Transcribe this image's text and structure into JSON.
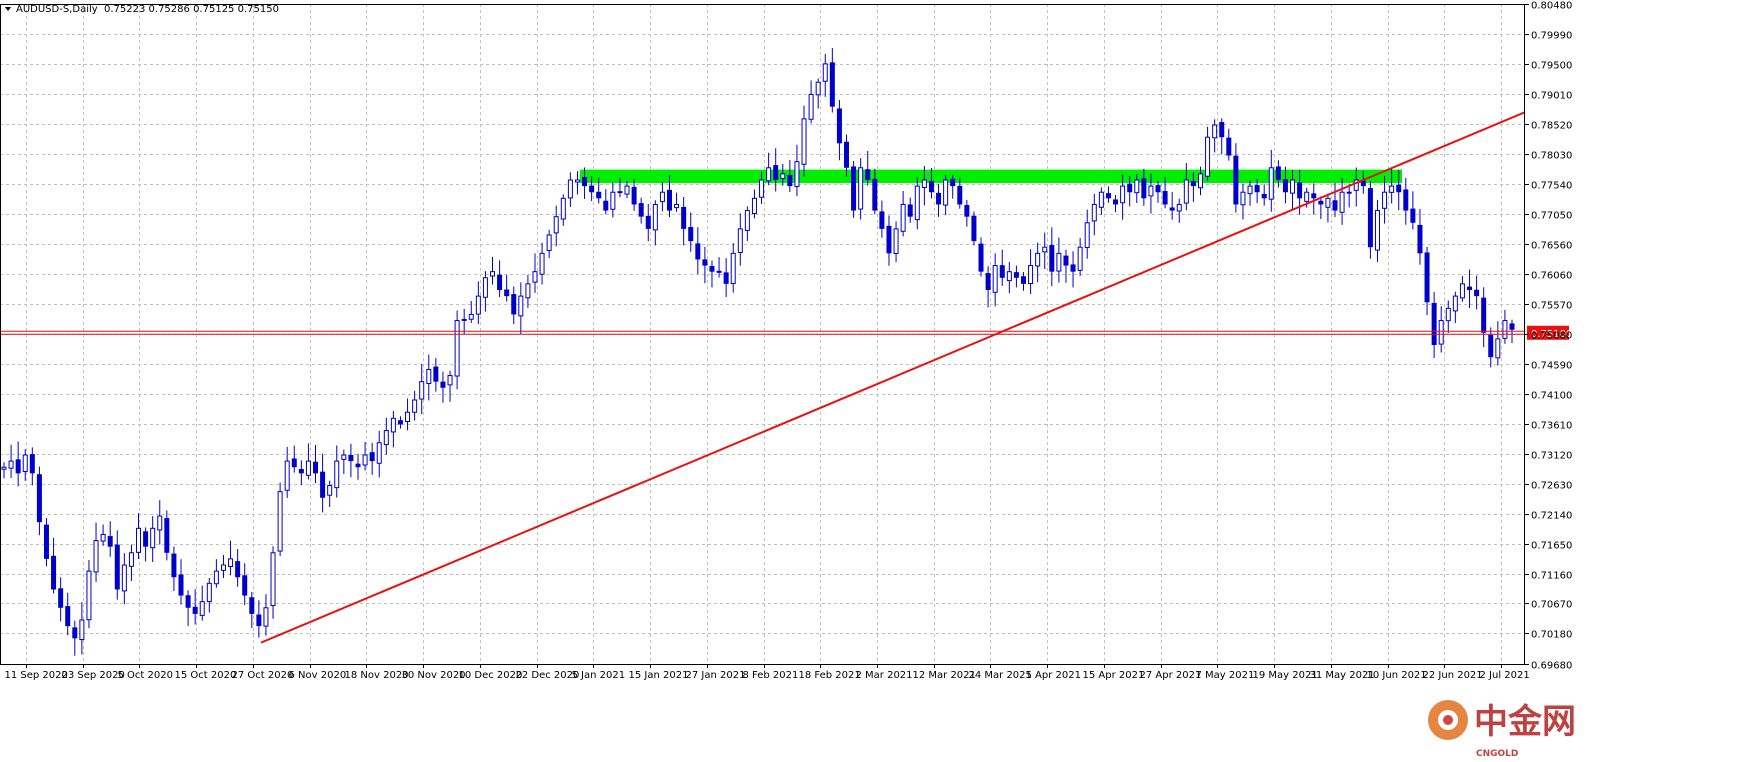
{
  "header": {
    "symbol_label": "AUDUSD-S,Daily",
    "ohlc_label": "0.75223 0.75286 0.75125 0.75150"
  },
  "colors": {
    "background": "#ffffff",
    "grid": "#c0c0c0",
    "candle": "#0000cc",
    "trendline": "#e81010",
    "resistance_band": "#00ee00",
    "price_line": "#e81010",
    "price_tag": "#e81010"
  },
  "watermark": {
    "brand": "中金网",
    "sub": "CNGOLD"
  },
  "chart_data": {
    "type": "candlestick",
    "symbol": "AUDUSD-S",
    "timeframe": "Daily",
    "current_price": 0.751,
    "current_price_label": "0.75100",
    "ylim": [
      0.6968,
      0.8048
    ],
    "y_ticks": [
      "0.80480",
      "0.79990",
      "0.79500",
      "0.79010",
      "0.78520",
      "0.78030",
      "0.77540",
      "0.77050",
      "0.76560",
      "0.76060",
      "0.75570",
      "0.75080",
      "0.74590",
      "0.74100",
      "0.73610",
      "0.73120",
      "0.72630",
      "0.72140",
      "0.71650",
      "0.71160",
      "0.70670",
      "0.70180",
      "0.69680"
    ],
    "x_labels": [
      "11 Sep 2020",
      "23 Sep 2020",
      "5 Oct 2020",
      "15 Oct 2020",
      "27 Oct 2020",
      "6 Nov 2020",
      "18 Nov 2020",
      "30 Nov 2020",
      "10 Dec 2020",
      "22 Dec 2020",
      "5 Jan 2021",
      "15 Jan 2021",
      "27 Jan 2021",
      "8 Feb 2021",
      "18 Feb 2021",
      "2 Mar 2021",
      "12 Mar 2021",
      "24 Mar 2021",
      "5 Apr 2021",
      "15 Apr 2021",
      "27 Apr 2021",
      "7 May 2021",
      "19 May 2021",
      "31 May 2021",
      "10 Jun 2021",
      "22 Jun 2021",
      "2 Jul 2021"
    ],
    "grid": true,
    "close_path": [
      0.729,
      0.73,
      0.728,
      0.731,
      0.728,
      0.72,
      0.714,
      0.709,
      0.706,
      0.703,
      0.701,
      0.704,
      0.712,
      0.717,
      0.718,
      0.716,
      0.709,
      0.713,
      0.715,
      0.719,
      0.716,
      0.719,
      0.721,
      0.715,
      0.711,
      0.708,
      0.706,
      0.705,
      0.707,
      0.71,
      0.712,
      0.713,
      0.714,
      0.711,
      0.708,
      0.705,
      0.703,
      0.706,
      0.715,
      0.725,
      0.73,
      0.729,
      0.728,
      0.73,
      0.728,
      0.724,
      0.726,
      0.73,
      0.731,
      0.73,
      0.729,
      0.731,
      0.73,
      0.733,
      0.735,
      0.737,
      0.736,
      0.738,
      0.74,
      0.743,
      0.745,
      0.743,
      0.742,
      0.744,
      0.753,
      0.753,
      0.754,
      0.757,
      0.76,
      0.761,
      0.758,
      0.757,
      0.754,
      0.757,
      0.759,
      0.761,
      0.764,
      0.767,
      0.77,
      0.773,
      0.776,
      0.776,
      0.775,
      0.774,
      0.773,
      0.771,
      0.774,
      0.774,
      0.775,
      0.772,
      0.77,
      0.768,
      0.772,
      0.774,
      0.771,
      0.772,
      0.768,
      0.766,
      0.763,
      0.762,
      0.761,
      0.761,
      0.759,
      0.764,
      0.768,
      0.771,
      0.773,
      0.776,
      0.778,
      0.776,
      0.777,
      0.775,
      0.779,
      0.786,
      0.79,
      0.792,
      0.795,
      0.788,
      0.782,
      0.778,
      0.771,
      0.778,
      0.776,
      0.771,
      0.768,
      0.764,
      0.768,
      0.772,
      0.77,
      0.775,
      0.776,
      0.774,
      0.772,
      0.776,
      0.775,
      0.772,
      0.77,
      0.766,
      0.761,
      0.758,
      0.762,
      0.76,
      0.761,
      0.76,
      0.759,
      0.762,
      0.764,
      0.765,
      0.761,
      0.764,
      0.762,
      0.761,
      0.765,
      0.769,
      0.772,
      0.774,
      0.773,
      0.772,
      0.775,
      0.774,
      0.776,
      0.773,
      0.775,
      0.774,
      0.772,
      0.771,
      0.772,
      0.776,
      0.775,
      0.777,
      0.783,
      0.785,
      0.783,
      0.78,
      0.772,
      0.774,
      0.775,
      0.774,
      0.773,
      0.778,
      0.776,
      0.774,
      0.776,
      0.773,
      0.774,
      0.773,
      0.772,
      0.773,
      0.771,
      0.774,
      0.774,
      0.776,
      0.775,
      0.765,
      0.771,
      0.774,
      0.775,
      0.774,
      0.771,
      0.769,
      0.764,
      0.756,
      0.749,
      0.753,
      0.755,
      0.757,
      0.759,
      0.758,
      0.757,
      0.751,
      0.747,
      0.75,
      0.753,
      0.7515
    ]
  }
}
